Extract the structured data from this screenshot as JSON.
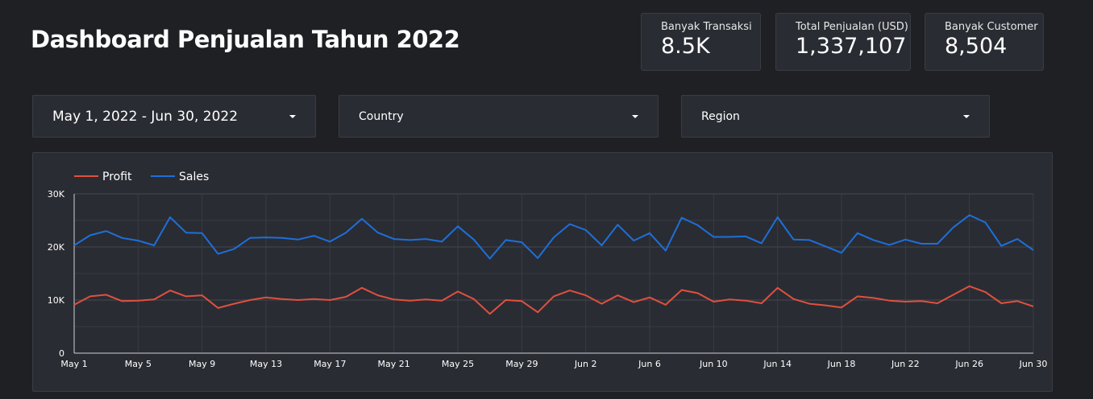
{
  "header": {
    "title": "Dashboard Penjualan Tahun 2022"
  },
  "kpis": [
    {
      "label": "Banyak Transaksi",
      "value": "8.5K"
    },
    {
      "label": "Total Penjualan (USD)",
      "value": "1,337,107"
    },
    {
      "label": "Banyak Customer",
      "value": "8,504"
    }
  ],
  "filters": {
    "date_range": {
      "value": "May 1, 2022 - Jun 30, 2022",
      "icon": "chevron-down-icon"
    },
    "country": {
      "placeholder": "Country",
      "icon": "chevron-down-icon"
    },
    "region": {
      "placeholder": "Region",
      "icon": "chevron-down-icon"
    }
  },
  "colors": {
    "background": "#1f2024",
    "panel": "#2a2c33",
    "profit": "#e0503f",
    "sales": "#1e6fd9"
  },
  "chart_data": {
    "type": "line",
    "legend_placement": "top-left",
    "grid": true,
    "ylim": [
      0,
      30000
    ],
    "y_ticks": [
      0,
      10000,
      20000,
      30000
    ],
    "y_tick_labels": [
      "0",
      "10K",
      "20K",
      "30K"
    ],
    "x_tick_labels": [
      "May 1",
      "May 5",
      "May 9",
      "May 13",
      "May 17",
      "May 21",
      "May 25",
      "May 29",
      "Jun 2",
      "Jun 6",
      "Jun 10",
      "Jun 14",
      "Jun 18",
      "Jun 22",
      "Jun 26",
      "Jun 30"
    ],
    "x": [
      "May 1",
      "May 2",
      "May 3",
      "May 4",
      "May 5",
      "May 6",
      "May 7",
      "May 8",
      "May 9",
      "May 10",
      "May 11",
      "May 12",
      "May 13",
      "May 14",
      "May 15",
      "May 16",
      "May 17",
      "May 18",
      "May 19",
      "May 20",
      "May 21",
      "May 22",
      "May 23",
      "May 24",
      "May 25",
      "May 26",
      "May 27",
      "May 28",
      "May 29",
      "May 30",
      "May 31",
      "Jun 1",
      "Jun 2",
      "Jun 3",
      "Jun 4",
      "Jun 5",
      "Jun 6",
      "Jun 7",
      "Jun 8",
      "Jun 9",
      "Jun 10",
      "Jun 11",
      "Jun 12",
      "Jun 13",
      "Jun 14",
      "Jun 15",
      "Jun 16",
      "Jun 17",
      "Jun 18",
      "Jun 19",
      "Jun 20",
      "Jun 21",
      "Jun 22",
      "Jun 23",
      "Jun 24",
      "Jun 25",
      "Jun 26",
      "Jun 27",
      "Jun 28",
      "Jun 29",
      "Jun 30"
    ],
    "series": [
      {
        "name": "Profit",
        "color": "#e0503f",
        "values": [
          9100,
          10700,
          11000,
          9800,
          9900,
          10100,
          11800,
          10700,
          10900,
          8500,
          9300,
          10000,
          10500,
          10200,
          10000,
          10200,
          10000,
          10600,
          12300,
          10900,
          10100,
          9900,
          10100,
          9900,
          11600,
          10200,
          7400,
          10000,
          9800,
          7700,
          10700,
          11800,
          10900,
          9300,
          10900,
          9600,
          10500,
          9100,
          11900,
          11300,
          9700,
          10100,
          9900,
          9400,
          12300,
          10200,
          9300,
          9000,
          8600,
          10700,
          10400,
          9900,
          9700,
          9800,
          9400,
          11000,
          12600,
          11500,
          9400,
          9800,
          8800
        ]
      },
      {
        "name": "Sales",
        "color": "#1e6fd9",
        "values": [
          20300,
          22200,
          23000,
          21700,
          21200,
          20300,
          25600,
          22700,
          22600,
          18700,
          19600,
          21700,
          21800,
          21700,
          21400,
          22100,
          21000,
          22700,
          25300,
          22700,
          21500,
          21300,
          21500,
          21000,
          23900,
          21400,
          17800,
          21300,
          20900,
          17900,
          21800,
          24300,
          23200,
          20300,
          24200,
          21200,
          22600,
          19300,
          25500,
          24100,
          21900,
          21900,
          22000,
          20700,
          25600,
          21400,
          21300,
          20100,
          18900,
          22600,
          21300,
          20400,
          21400,
          20600,
          20600,
          23700,
          26000,
          24600,
          20200,
          21500,
          19400
        ]
      }
    ]
  }
}
